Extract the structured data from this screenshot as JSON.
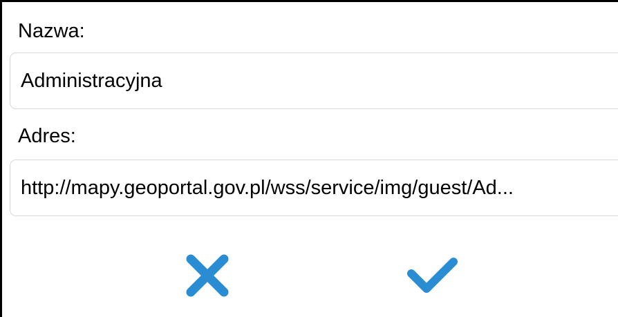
{
  "form": {
    "name_label": "Nazwa:",
    "name_value": "Administracyjna",
    "address_label": "Adres:",
    "address_value": "http://mapy.geoportal.gov.pl/wss/service/img/guest/Ad..."
  },
  "actions": {
    "cancel_icon": "close-icon",
    "confirm_icon": "checkmark-icon",
    "accent_color": "#2a8dd4"
  }
}
